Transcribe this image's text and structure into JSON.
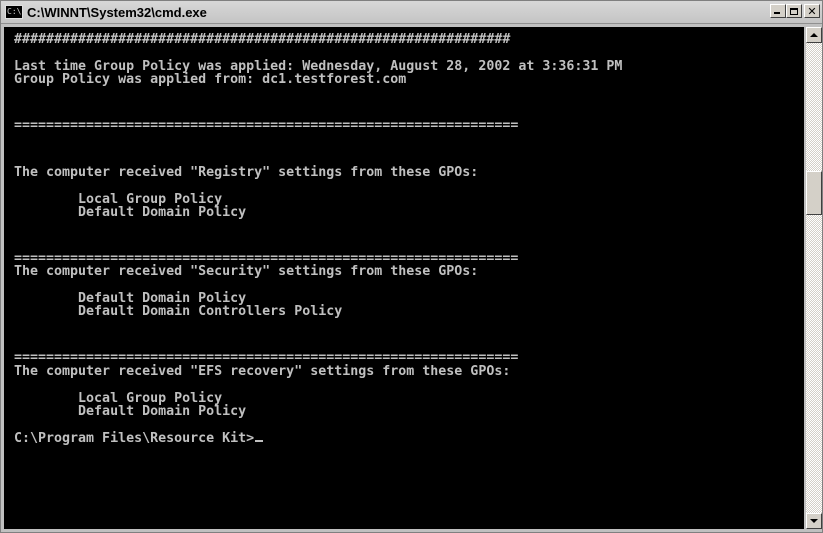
{
  "window": {
    "title": "C:\\WINNT\\System32\\cmd.exe",
    "icon_glyph": "C:\\"
  },
  "titlebar_buttons": {
    "minimize": "minimize",
    "maximize": "maximize",
    "close": "✕"
  },
  "console": {
    "lines": [
      "##############################################################",
      "Last time Group Policy was applied: Wednesday, August 28, 2002 at 3:36:31 PM",
      "Group Policy was applied from: dc1.testforest.com",
      "===============================================================",
      "The computer received \"Registry\" settings from these GPOs:",
      "        Local Group Policy",
      "        Default Domain Policy",
      "===============================================================",
      "The computer received \"Security\" settings from these GPOs:",
      "        Default Domain Policy",
      "        Default Domain Controllers Policy",
      "===============================================================",
      "The computer received \"EFS recovery\" settings from these GPOs:",
      "        Local Group Policy",
      "        Default Domain Policy",
      "C:\\Program Files\\Resource Kit>"
    ]
  },
  "colors": {
    "console_bg": "#000000",
    "console_text": "#c0c0c0",
    "titlebar": "#c4c4c4"
  }
}
